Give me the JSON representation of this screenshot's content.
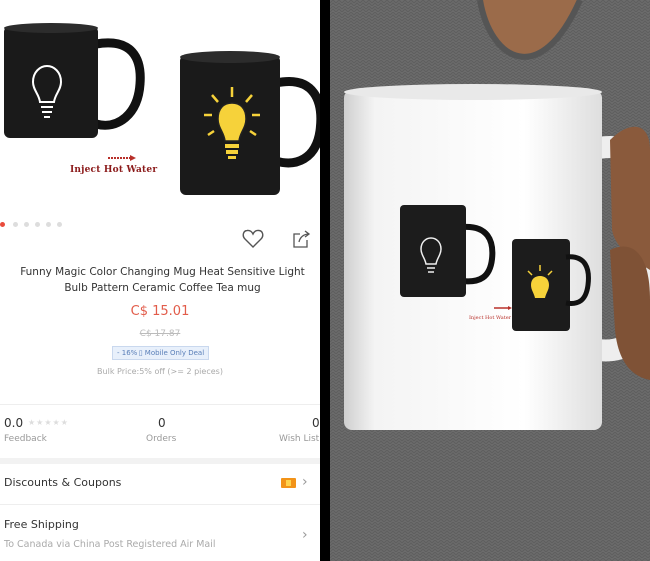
{
  "product": {
    "caption": "Inject Hot Water",
    "title": "Funny Magic Color Changing Mug Heat Sensitive Light Bulb Pattern Ceramic Coffee Tea mug",
    "price": "C$ 15.01",
    "old_price": "C$ 17.87",
    "deal": "- 16% ▯ Mobile Only Deal",
    "bulk": "Bulk Price:5% off (>= 2 pieces)",
    "carousel": {
      "count": 6,
      "active": 0
    }
  },
  "stats": {
    "feedback_value": "0.0",
    "feedback_stars": "★★★★★",
    "feedback_label": "Feedback",
    "orders_value": "0",
    "orders_label": "Orders",
    "wishlist_value": "0",
    "wishlist_label": "Wish List"
  },
  "rows": {
    "discounts_title": "Discounts & Coupons",
    "shipping_title": "Free Shipping",
    "shipping_sub": "To Canada via China Post Registered Air Mail"
  },
  "photo_print": {
    "caption": "Inject Hot Water"
  },
  "colors": {
    "price": "#e25c4a",
    "accent": "#f29318",
    "bulb": "#f6d23a",
    "arrow": "#b8302a"
  },
  "icons": [
    "heart-icon",
    "share-icon",
    "chevron-right-icon",
    "lightbulb-icon",
    "arrow-icon"
  ]
}
